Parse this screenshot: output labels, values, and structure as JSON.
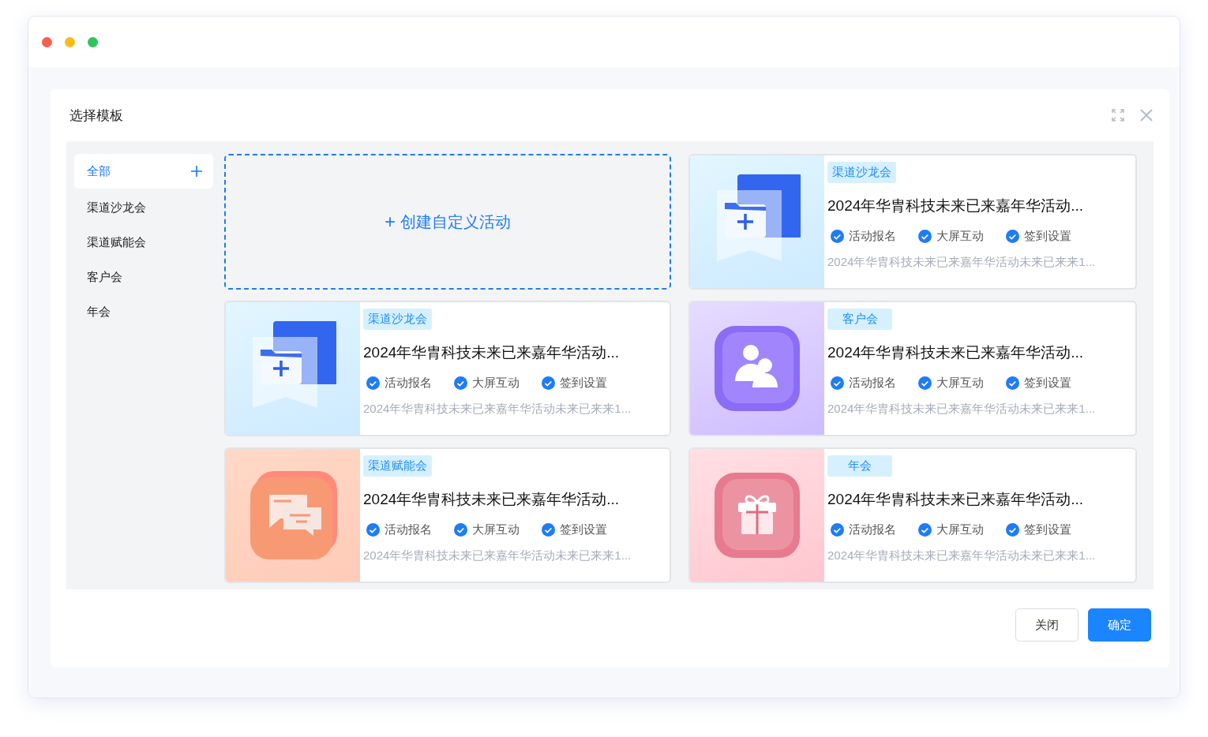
{
  "dialog": {
    "title": "选择模板"
  },
  "sidebar": {
    "items": [
      {
        "label": "全部",
        "selected": true
      },
      {
        "label": "渠道沙龙会",
        "selected": false
      },
      {
        "label": "渠道赋能会",
        "selected": false
      },
      {
        "label": "客户会",
        "selected": false
      },
      {
        "label": "年会",
        "selected": false
      }
    ]
  },
  "cards": [
    {
      "kind": "create",
      "icon": "+",
      "label": "创建自定义活动"
    },
    {
      "kind": "template",
      "artwork": {
        "kind": "folder"
      },
      "tag": "渠道沙龙会",
      "title": "2024年华胄科技未来已来嘉年华活动...",
      "features": [
        "活动报名",
        "大屏互动",
        "签到设置"
      ],
      "description": "2024年华胄科技未来已来嘉年华活动未来已来来1..."
    },
    {
      "kind": "template",
      "artwork": {
        "kind": "folder"
      },
      "tag": "渠道沙龙会",
      "title": "2024年华胄科技未来已来嘉年华活动...",
      "features": [
        "活动报名",
        "大屏互动",
        "签到设置"
      ],
      "description": "2024年华胄科技未来已来嘉年华活动未来已来来1..."
    },
    {
      "kind": "template",
      "artwork": {
        "kind": "people"
      },
      "tag": "客户会",
      "title": "2024年华胄科技未来已来嘉年华活动...",
      "features": [
        "活动报名",
        "大屏互动",
        "签到设置"
      ],
      "description": "2024年华胄科技未来已来嘉年华活动未来已来来1..."
    },
    {
      "kind": "template",
      "artwork": {
        "kind": "chat"
      },
      "tag": "渠道赋能会",
      "title": "2024年华胄科技未来已来嘉年华活动...",
      "features": [
        "活动报名",
        "大屏互动",
        "签到设置"
      ],
      "description": "2024年华胄科技未来已来嘉年华活动未来已来来1..."
    },
    {
      "kind": "template",
      "artwork": {
        "kind": "gift"
      },
      "tag": "年会",
      "title": "2024年华胄科技未来已来嘉年华活动...",
      "features": [
        "活动报名",
        "大屏互动",
        "签到设置"
      ],
      "description": "2024年华胄科技未来已来嘉年华活动未来已来来1..."
    }
  ],
  "buttons": [
    {
      "label": "关闭",
      "kind": "secondary"
    },
    {
      "label": "确定",
      "kind": "primary"
    }
  ]
}
